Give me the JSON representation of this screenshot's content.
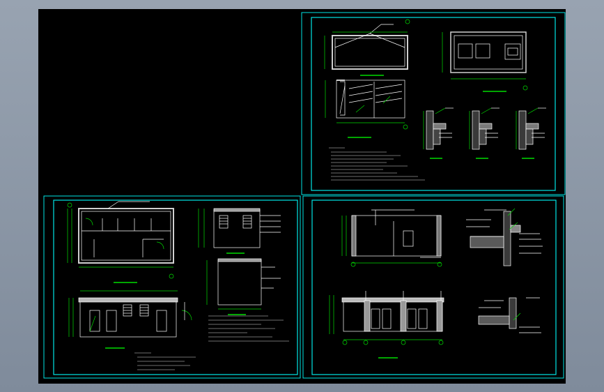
{
  "app": {
    "title": ""
  },
  "colors": {
    "background": "#000000",
    "frame": "#00e5e5",
    "line": "#ffffff",
    "dimension": "#00dd00",
    "wall": "#c8c8c8",
    "chrome": "#8c98a7"
  },
  "drawing": {
    "sheets": [
      {
        "id": "top-right-sheet",
        "views": [
          "plan",
          "roof-plan",
          "side-elevation",
          "detail-1",
          "detail-2",
          "detail-3",
          "notes"
        ]
      },
      {
        "id": "bottom-left-sheet",
        "views": [
          "floor-plan",
          "section-1",
          "section-2",
          "front-elevation",
          "notes"
        ]
      },
      {
        "id": "bottom-right-sheet",
        "views": [
          "rear-elevation",
          "front-elevation",
          "detail-1",
          "detail-2"
        ]
      }
    ]
  }
}
